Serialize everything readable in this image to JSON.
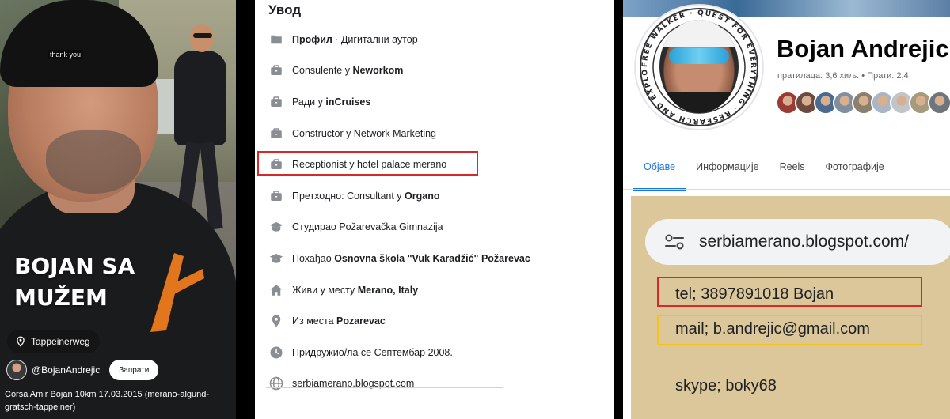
{
  "video": {
    "watermark": "thank you",
    "overlay_title": "BOJAN SA\nMUŽEM",
    "location": "Tappeinerweg",
    "channel": "@BojanAndrejic",
    "subscribe_label": "Запрати",
    "caption": "Corsa Amir Bojan 10km 17.03.2015 (merano-algund-gratsch-tappeiner)",
    "overlay_color": "#ffffff"
  },
  "intro": {
    "title": "Увод",
    "items": [
      {
        "icon": "profile-icon",
        "pre": "",
        "bold": "Профил",
        "post": " · Дигитални аутор"
      },
      {
        "icon": "briefcase-icon",
        "pre": "Consulente у ",
        "bold": "Neworkom",
        "post": ""
      },
      {
        "icon": "briefcase-icon",
        "pre": "Ради у ",
        "bold": "inCruises",
        "post": ""
      },
      {
        "icon": "briefcase-icon",
        "pre": "Constructor у Network Marketing",
        "bold": "",
        "post": ""
      },
      {
        "icon": "briefcase-icon",
        "pre": "Receptionist у hotel palace merano",
        "bold": "",
        "post": ""
      },
      {
        "icon": "briefcase-icon",
        "pre": "Претходно: Consultant у ",
        "bold": "Organo",
        "post": ""
      },
      {
        "icon": "graduation-cap-icon",
        "pre": "Студирао Požarevačka Gimnazija",
        "bold": "",
        "post": ""
      },
      {
        "icon": "graduation-cap-icon",
        "pre": "Похађао ",
        "bold": "Osnovna škola \"Vuk Karadžić\" Požarevac",
        "post": ""
      },
      {
        "icon": "home-icon",
        "pre": "Живи у месту ",
        "bold": "Merano, Italy",
        "post": ""
      },
      {
        "icon": "location-pin-icon",
        "pre": "Из места ",
        "bold": "Pozarevac",
        "post": ""
      },
      {
        "icon": "clock-icon",
        "pre": "Придружио/ла се Септембар 2008.",
        "bold": "",
        "post": ""
      },
      {
        "icon": "globe-icon",
        "pre": "serbiamerano.blogspot.com",
        "bold": "",
        "post": ""
      }
    ],
    "highlight_color": "#d62a2a"
  },
  "profile": {
    "name": "Bojan Andrejic",
    "stats": "пратилаца: 3,6 хиљ. • Прати: 2,4",
    "photo_ring_text": "FREE WALKER · QUEST FOR EVERYTHING · RESEARCH AND EXPLORE",
    "tabs": [
      "Објаве",
      "Информације",
      "Reels",
      "Фотографије"
    ],
    "active_tab": "Објаве",
    "accent_color": "#1b74e4",
    "friend_avatar_colors": [
      "#9a3b36",
      "#6b4a3f",
      "#4b6a8f",
      "#7f8fa0",
      "#8d7f6e",
      "#aab6c4",
      "#c1c4c8",
      "#a59a7d",
      "#6f757d"
    ]
  },
  "blog": {
    "url": "serbiamerano.blogspot.com/",
    "tel": "tel; 3897891018 Bojan",
    "mail": "mail; b.andrejic@gmail.com",
    "skype": "skype; boky68",
    "red_box_color": "#d62a2a",
    "yellow_box_color": "#f4c21a"
  }
}
